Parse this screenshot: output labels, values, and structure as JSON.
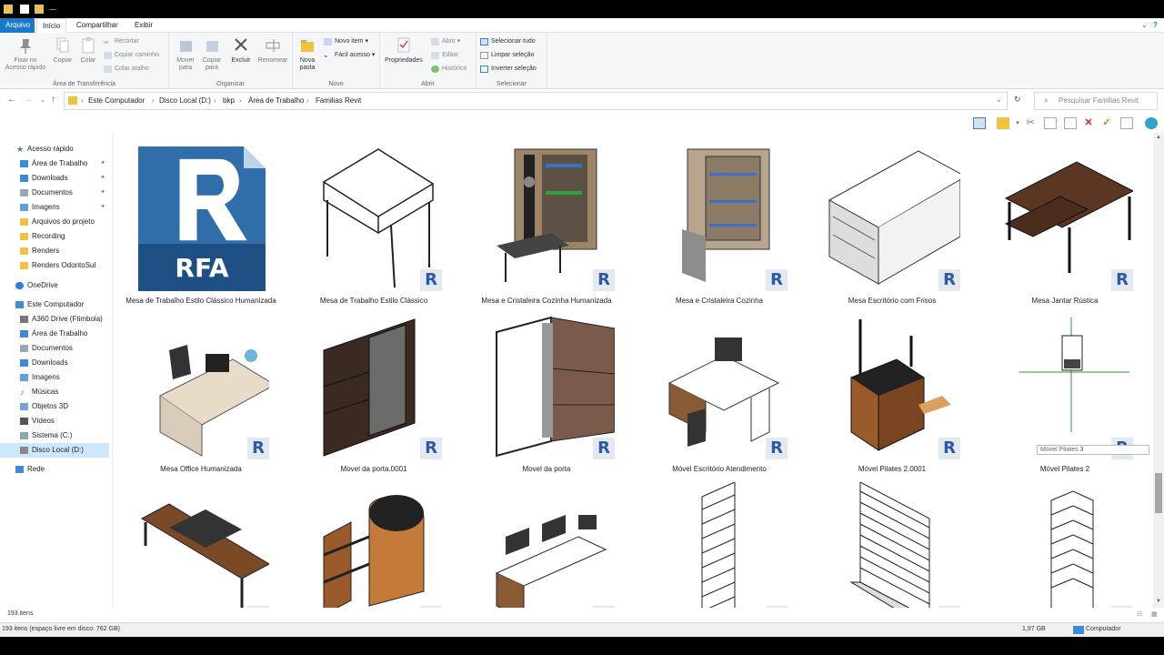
{
  "ribbon_tabs": [
    "Arquivo",
    "Início",
    "Compartilhar",
    "Exibir"
  ],
  "ribbon": {
    "clipboard": {
      "pin": "Fixar no Acesso rápido",
      "copy": "Copiar",
      "paste": "Colar",
      "cut": "Recortar",
      "copy_path": "Copiar caminho",
      "paste_shortcut": "Colar atalho",
      "label": "Área de Transferência"
    },
    "organize": {
      "move": "Mover para",
      "copy_to": "Copiar para",
      "delete": "Excluir",
      "rename": "Renomear",
      "label": "Organizar"
    },
    "new": {
      "new_folder": "Nova pasta",
      "new_item": "Novo item",
      "easy_access": "Fácil acesso",
      "label": "Novo"
    },
    "open": {
      "properties": "Propriedades",
      "open": "Abrir",
      "edit": "Editar",
      "history": "Histórico",
      "label": "Abrir"
    },
    "select": {
      "select_all": "Selecionar tudo",
      "select_none": "Limpar seleção",
      "invert": "Inverter seleção",
      "label": "Selecionar"
    }
  },
  "breadcrumb": [
    "Este Computador",
    "Disco Local (D:)",
    "bkp",
    "Área de Trabalho",
    "Familias Revit"
  ],
  "search_placeholder": "Pesquisar Familias Revit",
  "nav": {
    "quick_access": "Acesso rápido",
    "quick_items": [
      "Área de Trabalho",
      "Downloads",
      "Documentos",
      "Imagens",
      "Arquivos do projeto",
      "Recording",
      "Renders",
      "Renders OdontoSul"
    ],
    "onedrive": "OneDrive",
    "this_pc": "Este Computador",
    "pc_items": [
      "A360 Drive (Ftimbola)",
      "Área de Trabalho",
      "Documentos",
      "Downloads",
      "Imagens",
      "Músicas",
      "Objetos 3D",
      "Vídeos",
      "Sistema (C:)",
      "Disco Local (D:)"
    ],
    "network": "Rede"
  },
  "files_row1": [
    "Mesa de Trabalho Estilo Clássico Humanizada",
    "Mesa de Trabalho Estilo Clássico",
    "Mesa e Cristaleira Cozinha Humanizada",
    "Mesa e Cristaleira Cozinha",
    "Mesa Escritório com Frisos",
    "Mesa Jantar Rústica"
  ],
  "files_row2": [
    "Mesa Office Humanizada",
    "Movel da porta.0001",
    "Movel da porta",
    "Móvel Escritório Atendimento",
    "Móvel Pilates 2.0001",
    "Móvel Pilates 2"
  ],
  "rfa_text": "RFA",
  "r_badge": "R",
  "tooltip": "Móvel Pilates 3",
  "status": {
    "count": "193 itens",
    "free_space": "193 itens (espaço livre em disco: 762 GB)",
    "size": "1,97 GB",
    "location": "Computador"
  },
  "colors": {
    "accent": "#1979ca",
    "selection": "#cce8ff",
    "revit_blue": "#2c5aa8"
  }
}
